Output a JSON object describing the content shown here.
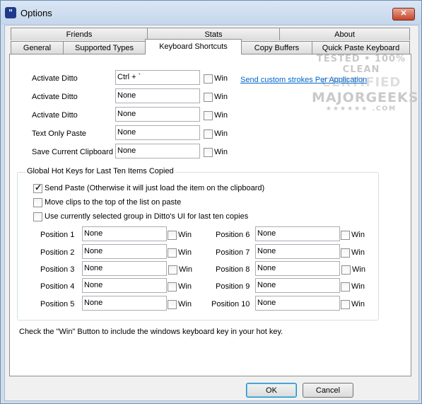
{
  "window": {
    "title": "Options",
    "close_label": "✕"
  },
  "tabs_row1": [
    "Friends",
    "Stats",
    "About"
  ],
  "tabs_row2": [
    "General",
    "Supported Types",
    "Keyboard Shortcuts",
    "Copy Buffers",
    "Quick Paste Keyboard"
  ],
  "active_tab": "Keyboard Shortcuts",
  "shortcuts": [
    {
      "label": "Activate Ditto",
      "value": "Ctrl + `",
      "win_label": "Win",
      "win_checked": false
    },
    {
      "label": "Activate Ditto",
      "value": "None",
      "win_label": "Win",
      "win_checked": false
    },
    {
      "label": "Activate Ditto",
      "value": "None",
      "win_label": "Win",
      "win_checked": false
    },
    {
      "label": "Text Only Paste",
      "value": "None",
      "win_label": "Win",
      "win_checked": false
    },
    {
      "label": "Save Current Clipboard",
      "value": "None",
      "win_label": "Win",
      "win_checked": false
    }
  ],
  "custom_link": "Send custom strokes Per Application",
  "group": {
    "title": "Global Hot Keys for Last Ten Items Copied",
    "options": [
      {
        "label": "Send Paste (Otherwise it will just load the item on the clipboard)",
        "checked": true
      },
      {
        "label": "Move clips to the top of the list on paste",
        "checked": false
      },
      {
        "label": "Use currently selected group in Ditto's UI for last ten copies",
        "checked": false
      }
    ],
    "positions_left": [
      {
        "label": "Position 1",
        "value": "None",
        "win_label": "Win"
      },
      {
        "label": "Position 2",
        "value": "None",
        "win_label": "Win"
      },
      {
        "label": "Position 3",
        "value": "None",
        "win_label": "Win"
      },
      {
        "label": "Position 4",
        "value": "None",
        "win_label": "Win"
      },
      {
        "label": "Position 5",
        "value": "None",
        "win_label": "Win"
      }
    ],
    "positions_right": [
      {
        "label": "Position 6",
        "value": "None",
        "win_label": "Win"
      },
      {
        "label": "Position 7",
        "value": "None",
        "win_label": "Win"
      },
      {
        "label": "Position 8",
        "value": "None",
        "win_label": "Win"
      },
      {
        "label": "Position 9",
        "value": "None",
        "win_label": "Win"
      },
      {
        "label": "Position 10",
        "value": "None",
        "win_label": "Win"
      }
    ]
  },
  "footer_note": "Check the \"Win\" Button to include the windows keyboard key in your hot key.",
  "buttons": {
    "ok": "OK",
    "cancel": "Cancel"
  },
  "watermark": {
    "line1": "TESTED • 100% CLEAN",
    "line2": "CERTIFIED",
    "line3": "MAJORGEEKS",
    "line4": "★★★★★★ .COM"
  }
}
